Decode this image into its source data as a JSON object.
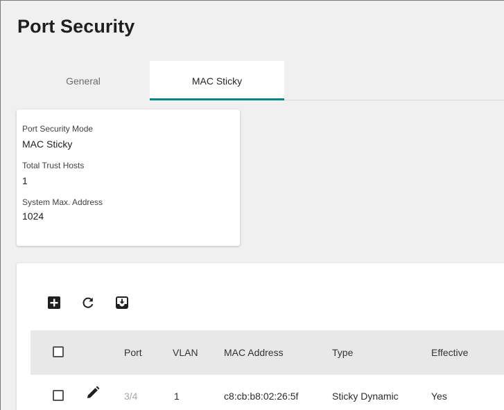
{
  "page": {
    "title": "Port Security"
  },
  "tabs": [
    {
      "label": "General",
      "active": false
    },
    {
      "label": "MAC Sticky",
      "active": true
    }
  ],
  "accent_color": "#008787",
  "summary": {
    "mode_label": "Port Security Mode",
    "mode_value": "MAC Sticky",
    "hosts_label": "Total Trust Hosts",
    "hosts_value": "1",
    "max_label": "System Max. Address",
    "max_value": "1024"
  },
  "toolbar": {
    "add_icon": "add-box-icon",
    "refresh_icon": "refresh-icon",
    "export_icon": "download-box-icon"
  },
  "table": {
    "columns": [
      "Port",
      "VLAN",
      "MAC Address",
      "Type",
      "Effective"
    ],
    "rows": [
      {
        "port": "3/4",
        "vlan": "1",
        "mac": "c8:cb:b8:02:26:5f",
        "type": "Sticky Dynamic",
        "effective": "Yes"
      }
    ]
  }
}
